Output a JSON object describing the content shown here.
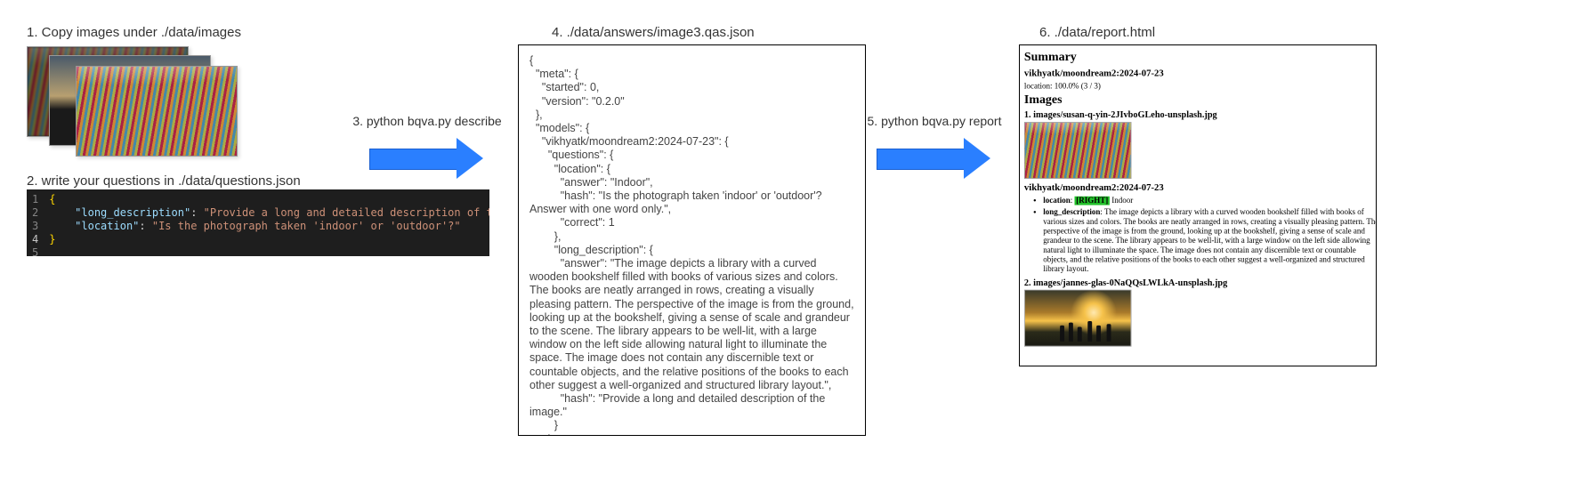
{
  "steps": {
    "s1": "1. Copy images under ./data/images",
    "s2": "2. write your questions in ./data/questions.json",
    "s3": "3. python bqva.py describe",
    "s4": "4. ./data/answers/image3.qas.json",
    "s5": "5. python bqva.py report",
    "s6": "6. ./data/report.html"
  },
  "questions_json": {
    "long_description_key": "\"long_description\"",
    "long_description_val": "\"Provide a long and detailed description of the image.\"",
    "location_key": "\"location\"",
    "location_val": "\"Is the photograph taken 'indoor' or 'outdoor'?\""
  },
  "answers_json_text": "{\n  \"meta\": {\n    \"started\": 0,\n    \"version\": \"0.2.0\"\n  },\n  \"models\": {\n    \"vikhyatk/moondream2:2024-07-23\": {\n      \"questions\": {\n        \"location\": {\n          \"answer\": \"Indoor\",\n          \"hash\": \"Is the photograph taken 'indoor' or 'outdoor'? Answer with one word only.\",\n          \"correct\": 1\n        },\n        \"long_description\": {\n          \"answer\": \"The image depicts a library with a curved wooden bookshelf filled with books of various sizes and colors. The books are neatly arranged in rows, creating a visually pleasing pattern. The perspective of the image is from the ground, looking up at the bookshelf, giving a sense of scale and grandeur to the scene. The library appears to be well-lit, with a large window on the left side allowing natural light to illuminate the space. The image does not contain any discernible text or countable objects, and the relative positions of the books to each other suggest a well-organized and structured library layout.\",\n          \"hash\": \"Provide a long and detailed description of the image.\"\n        }\n      }",
  "report": {
    "summary_title": "Summary",
    "model": "vikhyatk/moondream2:2024-07-23",
    "location_stat": "location: 100.0% (3 / 3)",
    "images_title": "Images",
    "img1_title": "1. images/susan-q-yin-2JIvboGLeho-unsplash.jpg",
    "img1_model": "vikhyatk/moondream2:2024-07-23",
    "img1_loc_label": "location",
    "img1_loc_tag": "[RIGHT]",
    "img1_loc_val": "Indoor",
    "img1_ld_label": "long_description",
    "img1_ld_val": "The image depicts a library with a curved wooden bookshelf filled with books of various sizes and colors. The books are neatly arranged in rows, creating a visually pleasing pattern. The perspective of the image is from the ground, looking up at the bookshelf, giving a sense of scale and grandeur to the scene. The library appears to be well-lit, with a large window on the left side allowing natural light to illuminate the space. The image does not contain any discernible text or countable objects, and the relative positions of the books to each other suggest a well-organized and structured library layout.",
    "img2_title": "2. images/jannes-glas-0NaQQsLWLkA-unsplash.jpg"
  },
  "gutter_lines": [
    "1",
    "2",
    "3",
    "4",
    "5"
  ]
}
